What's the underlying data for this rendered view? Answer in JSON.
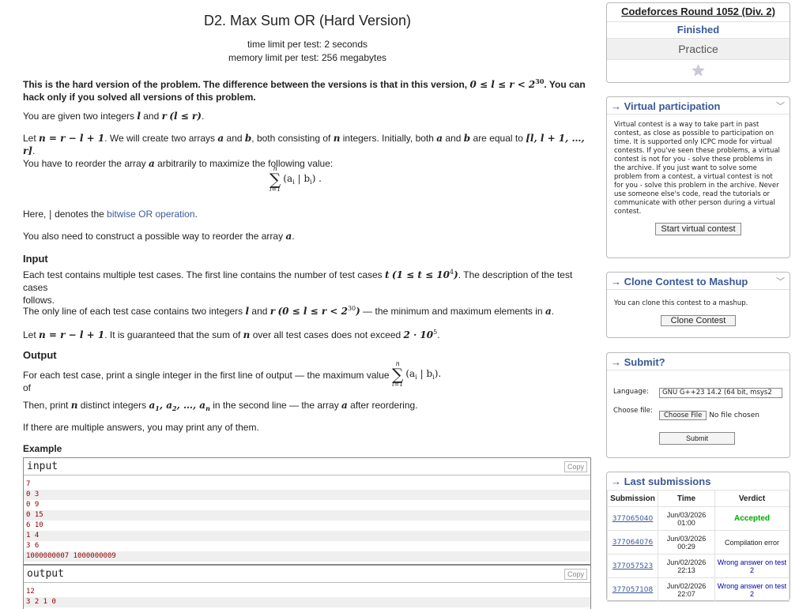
{
  "problem": {
    "title": "D2. Max Sum OR (Hard Version)",
    "time_limit": "time limit per test: 2 seconds",
    "memory_limit": "memory limit per test: 256 megabytes",
    "intro": "This is the hard version of the problem. The difference between the versions is that in this version,",
    "intro_math": "0 ≤ l ≤ r < 2",
    "intro_exp": "30",
    "intro_tail": ". You can",
    "intro_line2": "hack only if you solved all versions of this problem.",
    "given": "You are given two integers",
    "given_l": "l",
    "given_and": "and",
    "given_r": "r",
    "given_cond": "(l ≤ r)",
    "let_prefix": "Let",
    "let_math": "n = r − l + 1",
    "let_text": ". We will create two arrays",
    "let_a": "a",
    "let_and": "and",
    "let_b": "b",
    "let_text2": ", both consisting of",
    "let_n": "n",
    "let_text3": "integers. Initially, both",
    "let_a2": "a",
    "let_and2": "and",
    "let_b2": "b",
    "let_text4": "are equal to",
    "let_range": "[l, l + 1, …, r]",
    "let_dot": ".",
    "reorder": "You have to reorder the array",
    "reorder_a": "a",
    "reorder_tail": "arbitrarily to maximize the following value:",
    "sum_top": "n",
    "sum_bot": "i=1",
    "sum_expr": "(a",
    "sum_i": "i",
    "sum_mid": " | b",
    "sum_i2": "i",
    "sum_end": ") .",
    "here": "Here,",
    "here_bar": "|",
    "here_mid": "denotes the",
    "here_link": "bitwise OR operation",
    "here_dot": ".",
    "also": "You also need to construct a possible way to reorder the array",
    "also_a": "a",
    "also_dot": "."
  },
  "input_section": {
    "heading": "Input",
    "p1": "Each test contains multiple test cases. The first line contains the number of test cases",
    "p1_t": "t",
    "p1_math": "(1 ≤ t ≤ 10",
    "p1_exp": "4",
    "p1_close": ")",
    "p1_tail": ". The description of the test cases",
    "p1_line2": "follows.",
    "p2": "The only line of each test case contains two integers",
    "p2_l": "l",
    "p2_and": "and",
    "p2_r": "r",
    "p2_math": "(0 ≤ l ≤ r < 2",
    "p2_exp": "30",
    "p2_close": ")",
    "p2_tail": "— the minimum and maximum elements in",
    "p2_a": "a",
    "p2_dot": ".",
    "p3_prefix": "Let",
    "p3_math": "n = r − l + 1",
    "p3_mid": ". It is guaranteed that the sum of",
    "p3_n": "n",
    "p3_tail": "over all test cases does not exceed",
    "p3_val": "2 · 10",
    "p3_exp": "5",
    "p3_dot": "."
  },
  "output_section": {
    "heading": "Output",
    "p1": "For each test case, print a single integer in the first line of output — the maximum value of",
    "sum_top": "n",
    "sum_bot": "i=1",
    "sum_expr": "(a",
    "sum_i": "i",
    "sum_mid": " | b",
    "sum_i2": "i",
    "sum_end": ").",
    "p2_prefix": "Then, print",
    "p2_n": "n",
    "p2_mid": "distinct integers",
    "p2_list": "a",
    "p2_tail": "in the second line — the array",
    "p2_a": "a",
    "p2_end": "after reordering.",
    "p3": "If there are multiple answers, you may print any of them."
  },
  "example": {
    "heading": "Example",
    "input_label": "input",
    "output_label": "output",
    "copy": "Copy",
    "input_lines": [
      "7",
      "0 3",
      "0 9",
      "0 15",
      "6 10",
      "1 4",
      "3 6",
      "1000000007 1000000009"
    ],
    "output_lines": [
      "12",
      "3 2 1 0"
    ]
  },
  "sidebar": {
    "round": {
      "name": "Codeforces Round 1052 (Div. 2)",
      "status": "Finished",
      "mode": "Practice"
    },
    "virtual": {
      "title": "→ Virtual participation",
      "text": "Virtual contest is a way to take part in past contest, as close as possible to participation on time. It is supported only ICPC mode for virtual contests. If you've seen these problems, a virtual contest is not for you - solve these problems in the archive. If you just want to solve some problem from a contest, a virtual contest is not for you - solve this problem in the archive. Never use someone else's code, read the tutorials or communicate with other person during a virtual contest.",
      "button": "Start virtual contest"
    },
    "clone": {
      "title": "→ Clone Contest to Mashup",
      "text": "You can clone this contest to a mashup.",
      "button": "Clone Contest"
    },
    "submit": {
      "title": "→ Submit?",
      "language_label": "Language:",
      "language_value": "GNU G++23 14.2 (64 bit, msys2",
      "file_label": "Choose file:",
      "file_button": "Choose File",
      "file_status": "No file chosen",
      "submit_button": "Submit"
    },
    "last": {
      "title": "→ Last submissions",
      "headers": [
        "Submission",
        "Time",
        "Verdict"
      ],
      "rows": [
        {
          "id": "377065040",
          "time": "Jun/03/2026 01:00",
          "verdict": "Accepted"
        },
        {
          "id": "377064076",
          "time": "Jun/03/2026 00:29",
          "verdict": "Compilation error"
        },
        {
          "id": "377057523",
          "time": "Jun/02/2026 22:13",
          "verdict": "Wrong answer on test 2"
        },
        {
          "id": "377057108",
          "time": "Jun/02/2026 22:07",
          "verdict": "Wrong answer on test 2"
        }
      ]
    }
  }
}
